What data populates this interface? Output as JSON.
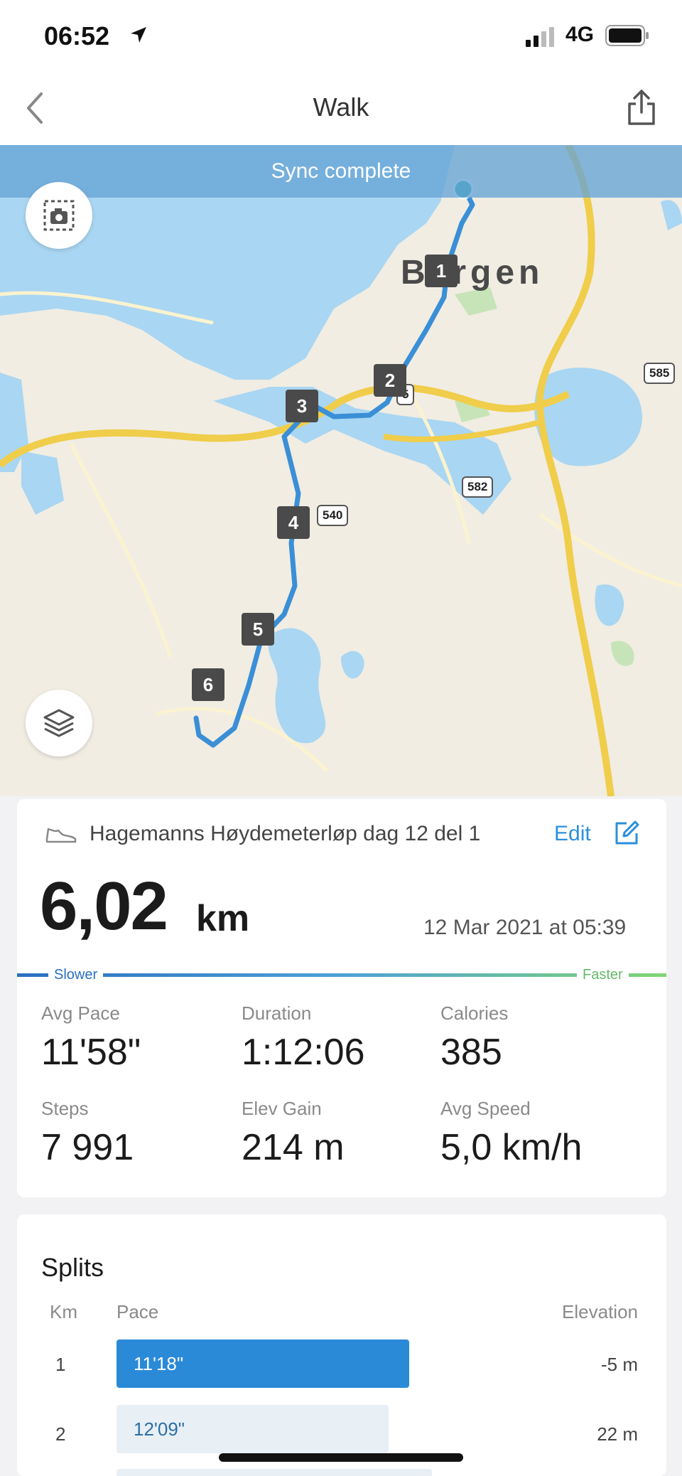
{
  "status": {
    "time": "06:52",
    "network": "4G"
  },
  "nav": {
    "title": "Walk"
  },
  "map": {
    "sync_text": "Sync complete",
    "city_label": "Bergen",
    "roads": [
      "585",
      "5",
      "582",
      "540"
    ],
    "markers": [
      "1",
      "2",
      "3",
      "4",
      "5",
      "6"
    ],
    "route_color": "#3a8fd6",
    "water_color": "#a9d6f2",
    "road_color": "#f0cd4a"
  },
  "activity": {
    "name": "Hagemanns Høydemeterløp dag 12 del 1",
    "edit_label": "Edit",
    "distance": "6,02",
    "distance_unit": "km",
    "date": "12 Mar 2021 at 05:39",
    "pace_slower": "Slower",
    "pace_faster": "Faster"
  },
  "stats": [
    {
      "label": "Avg Pace",
      "value": "11'58\""
    },
    {
      "label": "Duration",
      "value": "1:12:06"
    },
    {
      "label": "Calories",
      "value": "385"
    },
    {
      "label": "Steps",
      "value": "7 991"
    },
    {
      "label": "Elev Gain",
      "value": "214 m"
    },
    {
      "label": "Avg Speed",
      "value": "5,0 km/h"
    }
  ],
  "splits": {
    "title": "Splits",
    "headers": {
      "km": "Km",
      "pace": "Pace",
      "elevation": "Elevation"
    },
    "rows": [
      {
        "km": "1",
        "pace": "11'18\"",
        "elevation": "-5 m",
        "relative_speed": 1.0
      },
      {
        "km": "2",
        "pace": "12'09\"",
        "elevation": "22 m",
        "relative_speed": 0.93
      }
    ]
  }
}
